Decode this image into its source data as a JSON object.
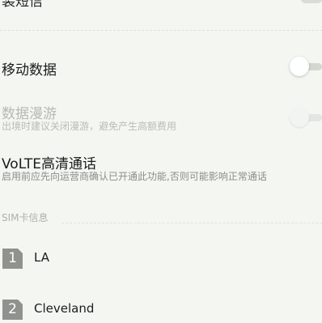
{
  "top_partial": {
    "title": "装短信"
  },
  "mobile_data": {
    "title": "移动数据",
    "enabled": false
  },
  "roaming": {
    "title": "数据漫游",
    "subtitle": "出境时建议关闭漫游，避免产生高额费用",
    "enabled": false,
    "disabled": true
  },
  "volte": {
    "title": "VoLTE高清通话",
    "subtitle": "启用前应先向运营商确认已开通此功能,否则可能影响正常通话"
  },
  "sim_info": {
    "header": "SIM卡信息",
    "cards": [
      {
        "slot": "1",
        "name": "LA"
      },
      {
        "slot": "2",
        "name": "Cleveland"
      }
    ]
  }
}
